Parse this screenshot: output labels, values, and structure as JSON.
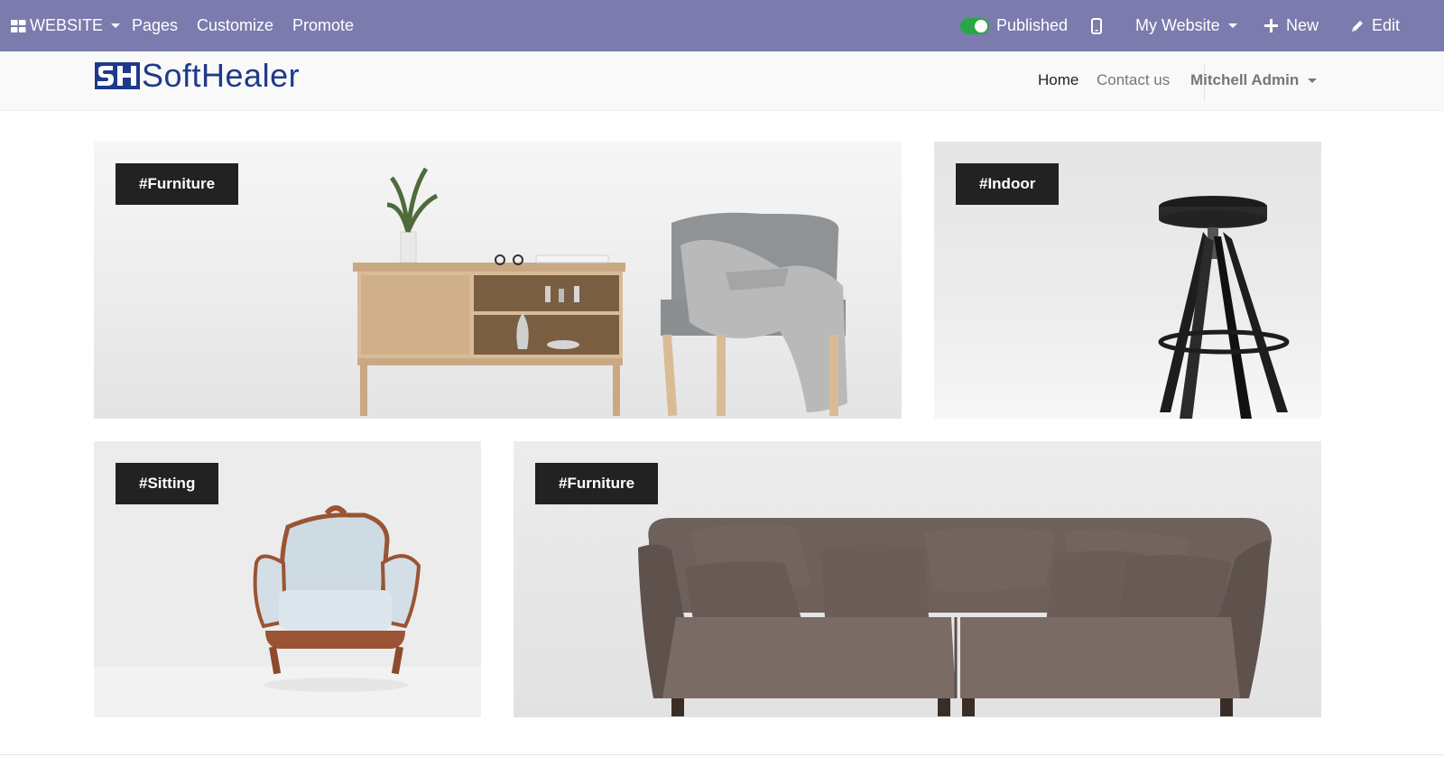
{
  "topbar": {
    "app_label": "WEBSITE",
    "menu": [
      "Pages",
      "Customize",
      "Promote"
    ],
    "published_label": "Published",
    "website_selector": "My Website",
    "new_label": "New",
    "edit_label": "Edit"
  },
  "header": {
    "logo_text": "SoftHealer",
    "nav": {
      "home": "Home",
      "contact": "Contact us",
      "user": "Mitchell Admin"
    }
  },
  "cards": [
    {
      "tag": "#Furniture"
    },
    {
      "tag": "#Indoor"
    },
    {
      "tag": "#Sitting"
    },
    {
      "tag": "#Furniture"
    }
  ],
  "colors": {
    "topbar_bg": "#7c7bad",
    "toggle_on": "#28a745",
    "logo_blue": "#1e3a8a",
    "tag_bg": "#222222"
  }
}
